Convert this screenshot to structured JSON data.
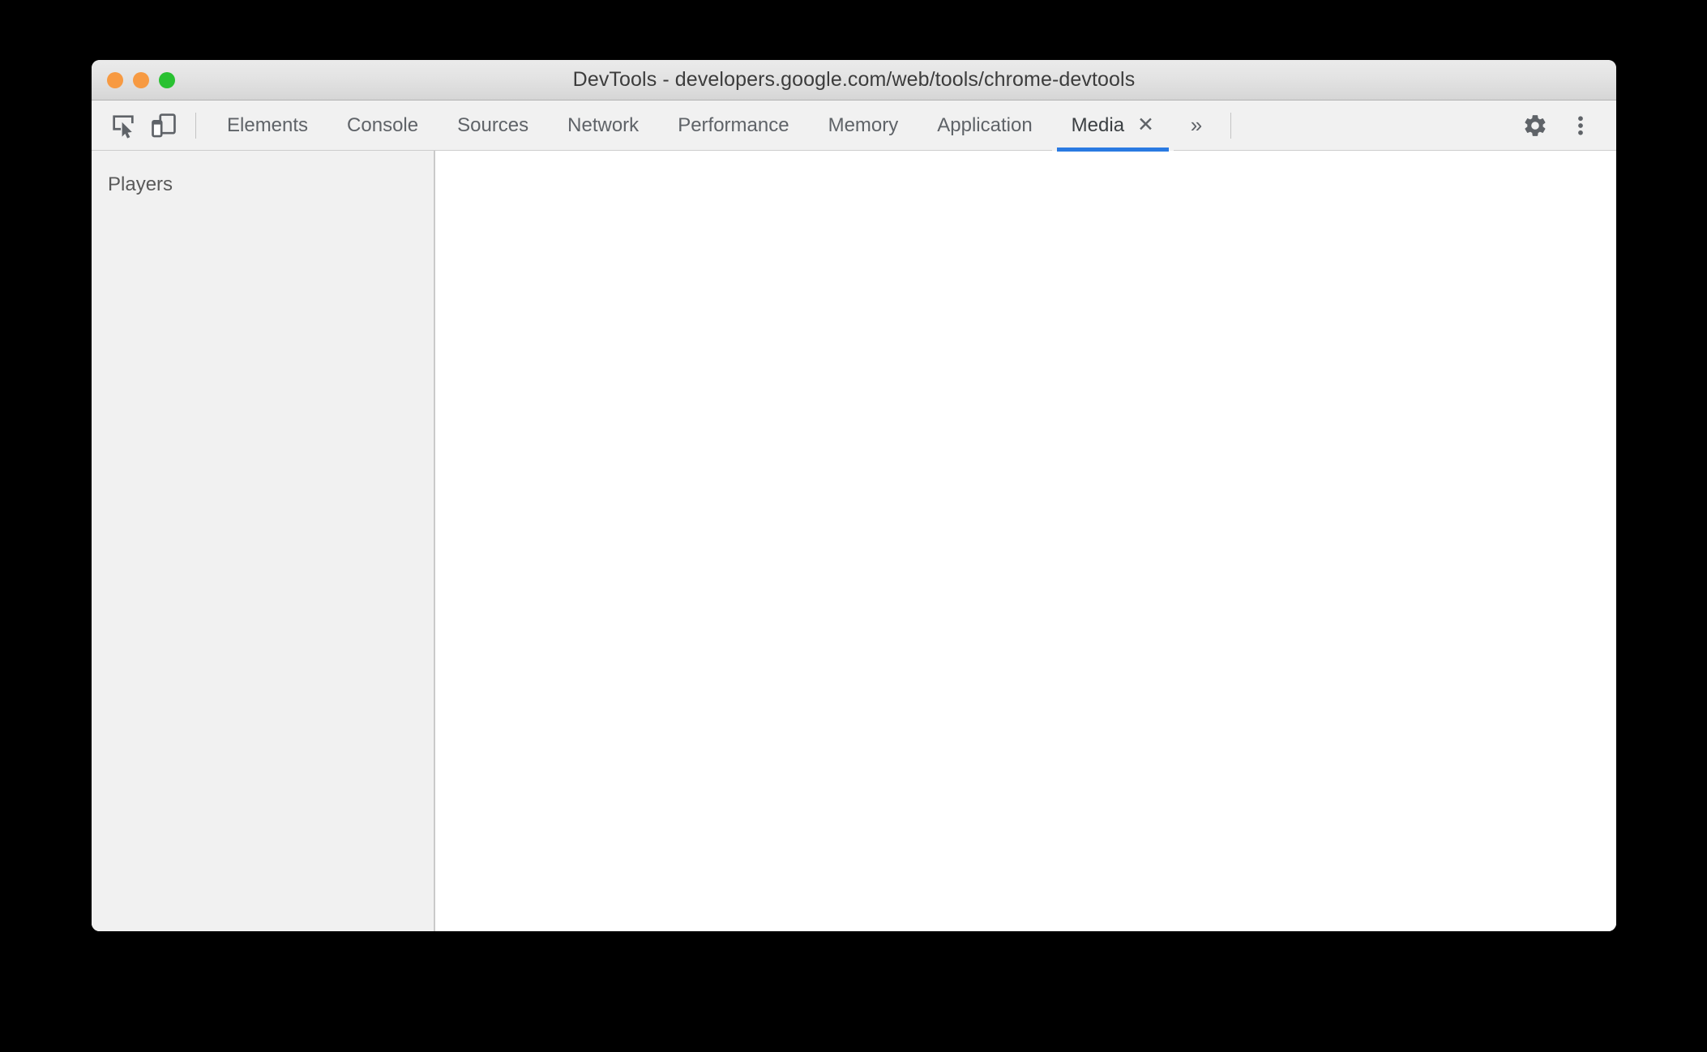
{
  "window": {
    "title": "DevTools - developers.google.com/web/tools/chrome-devtools",
    "traffic_lights": [
      {
        "name": "close",
        "color": "#f79a42"
      },
      {
        "name": "minimize",
        "color": "#f79a42"
      },
      {
        "name": "maximize",
        "color": "#29c131"
      }
    ]
  },
  "toolbar": {
    "inspect_icon": "inspect-element-icon",
    "device_icon": "device-toolbar-icon",
    "overflow_label": "»",
    "settings_icon": "gear-icon",
    "more_icon": "more-vertical-icon",
    "tabs": [
      {
        "label": "Elements",
        "selected": false
      },
      {
        "label": "Console",
        "selected": false
      },
      {
        "label": "Sources",
        "selected": false
      },
      {
        "label": "Network",
        "selected": false
      },
      {
        "label": "Performance",
        "selected": false
      },
      {
        "label": "Memory",
        "selected": false
      },
      {
        "label": "Application",
        "selected": false
      },
      {
        "label": "Media",
        "selected": true,
        "close_label": "✕"
      }
    ],
    "accent_color": "#2a7ae2"
  },
  "sidebar": {
    "title": "Players"
  },
  "content": {
    "body_text": ""
  }
}
